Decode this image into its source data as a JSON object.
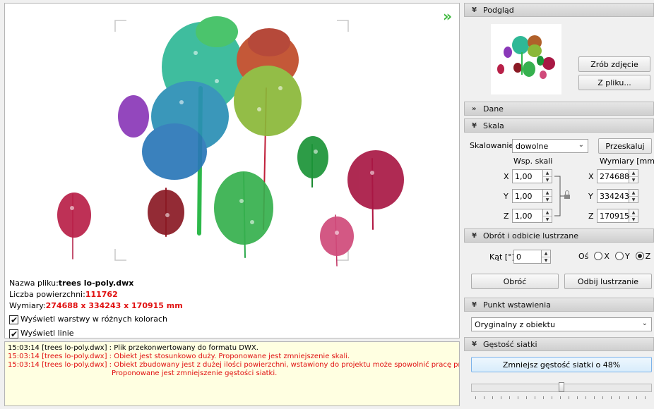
{
  "info": {
    "file_label": "Nazwa pliku:",
    "file_name": "trees lo-poly.dwx",
    "surfaces_label": "Liczba powierzchni:",
    "surfaces_value": "111762",
    "dims_label": "Wymiary:",
    "dims_value": "274688 x 334243 x 170915 mm",
    "show_layers_label": "Wyświetl warstwy w różnych kolorach",
    "show_lines_label": "Wyświetl linie"
  },
  "log": [
    {
      "time": "15:03:14",
      "text": "[trees lo-poly.dwx] : Plik przekonwertowany do formatu DWX.",
      "level": "info"
    },
    {
      "time": "15:03:14",
      "text": "[trees lo-poly.dwx] : Obiekt jest stosunkowo duży. Proponowane jest zmniejszenie skali.",
      "level": "error"
    },
    {
      "time": "15:03:14",
      "text": "[trees lo-poly.dwx] : Obiekt zbudowany jest z dużej ilości powierzchni, wstawiony do projektu może spowolnić pracę programu.",
      "level": "error"
    },
    {
      "time": "",
      "text": "Proponowane jest zmniejszenie gęstości siatki.",
      "level": "error"
    }
  ],
  "panels": {
    "preview": {
      "title": "Podgląd",
      "take_photo": "Zrób zdjęcie",
      "from_file": "Z pliku..."
    },
    "data": {
      "title": "Dane"
    },
    "scale": {
      "title": "Skala",
      "scaling_label": "Skalowanie",
      "scaling_value": "dowolne",
      "rescale_button": "Przeskaluj",
      "scale_header": "Wsp. skali",
      "dims_header": "Wymiary [mm]",
      "x_label": "X",
      "y_label": "Y",
      "z_label": "Z",
      "scale_x": "1,00",
      "scale_y": "1,00",
      "scale_z": "1,00",
      "dim_x": "274688",
      "dim_y": "334243",
      "dim_z": "170915"
    },
    "rotation": {
      "title": "Obrót i odbicie lustrzane",
      "angle_label": "Kąt [°]",
      "angle_value": "0",
      "axis_label": "Oś",
      "axis_x": "X",
      "axis_y": "Y",
      "axis_z": "Z",
      "selected_axis": "Z",
      "rotate_button": "Obróć",
      "mirror_button": "Odbij lustrzanie"
    },
    "insertion": {
      "title": "Punkt wstawienia",
      "value": "Oryginalny z obiektu"
    },
    "mesh": {
      "title": "Gęstość siatki",
      "reduce_button": "Zmniejsz gęstość siatki o 48%",
      "reduction_percent": 48
    }
  },
  "icons": {
    "expand": "double-chevron-right-icon",
    "collapse": "double-chevron-down-icon"
  }
}
